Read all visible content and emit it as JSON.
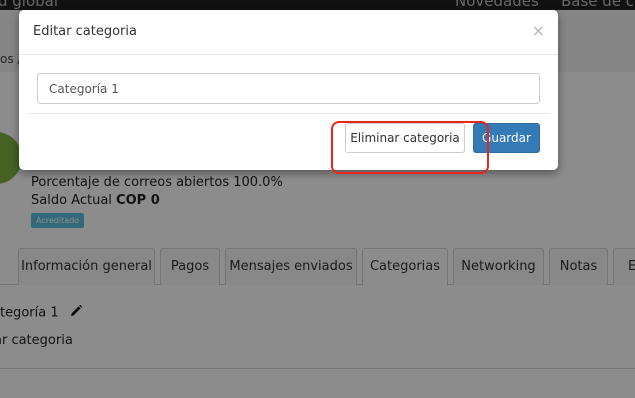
{
  "topbar": {
    "brand_fragment": "d global",
    "nav_novedades": "Novedades",
    "nav_base": "Base de co"
  },
  "breadcrumb": {
    "fragment": "os  /"
  },
  "contact": {
    "open_rate_label": "Porcentaje de correos abiertos 100.0%",
    "balance_label": "Saldo Actual",
    "balance_value": "COP 0",
    "badge": "Acreditado"
  },
  "tabs": [
    {
      "label": "Información general"
    },
    {
      "label": "Pagos"
    },
    {
      "label": "Mensajes enviados"
    },
    {
      "label": "Categorias"
    },
    {
      "label": "Networking"
    },
    {
      "label": "Notas"
    },
    {
      "label": "E"
    }
  ],
  "categories": {
    "item_label": "ategoría 1",
    "add_label": "ar categoria"
  },
  "modal": {
    "title": "Editar categoria",
    "close_symbol": "×",
    "input_value": "Categoría 1",
    "delete_label": "Eliminar categoria",
    "save_label": "Guardar"
  },
  "colors": {
    "primary": "#337ab7",
    "badge": "#5bc0de",
    "avatar": "#7fb241",
    "highlight": "#e8261e"
  }
}
